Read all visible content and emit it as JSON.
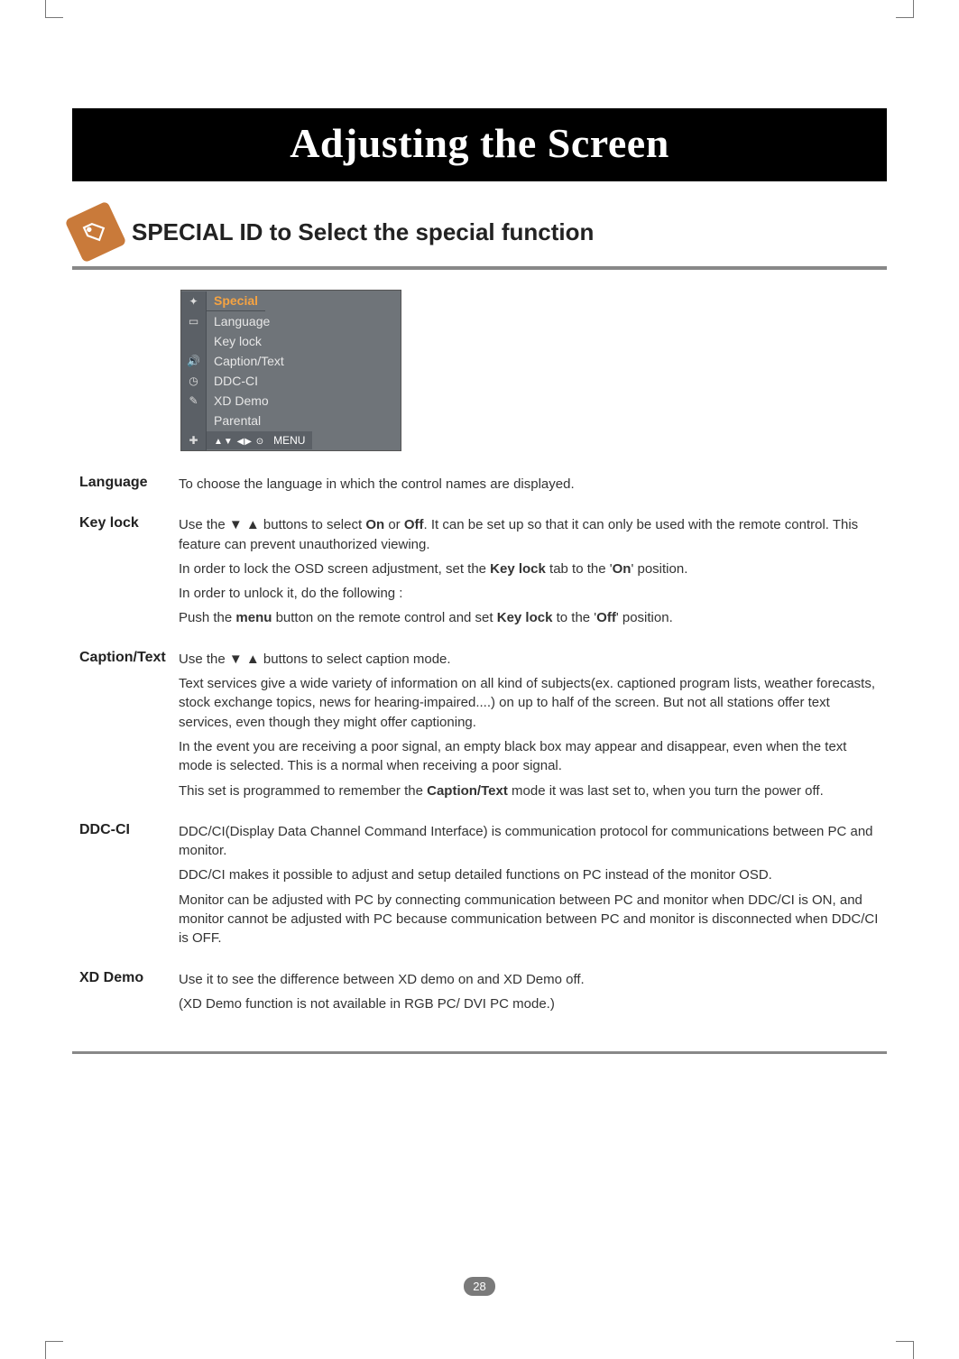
{
  "title": "Adjusting the Screen",
  "section_heading": "SPECIAL ID to Select the special function",
  "osd": {
    "header": "Special",
    "items": [
      "Language",
      "Key lock",
      "Caption/Text",
      "DDC-CI",
      "XD Demo",
      "Parental"
    ],
    "footer_glyphs": "▲▼  ◀▶  ⊙",
    "footer_label": "MENU"
  },
  "definitions": {
    "language": {
      "label": "Language",
      "text": "To choose the language in which the control names are displayed."
    },
    "keylock": {
      "label": "Key lock",
      "p1_prefix": "Use the ",
      "p1_glyphs": "▼ ▲",
      "p1_mid": " buttons to select ",
      "p1_on": "On",
      "p1_or": " or ",
      "p1_off": "Off",
      "p1_suffix": ". It can be set up so that it can only be used with the remote control. This feature can prevent unauthorized viewing.",
      "p2_a": "In order to lock the OSD screen adjustment, set the ",
      "p2_b": "Key lock",
      "p2_c": " tab to the '",
      "p2_d": "On",
      "p2_e": "' position.",
      "p3": "In order to unlock it, do the following :",
      "p4_a": "Push the ",
      "p4_b": "menu",
      "p4_c": " button on the remote control and set ",
      "p4_d": "Key lock",
      "p4_e": " to the '",
      "p4_f": "Off",
      "p4_g": "' position."
    },
    "caption": {
      "label": "Caption/Text",
      "p1_prefix": "Use the ",
      "p1_glyphs": "▼ ▲",
      "p1_suffix": " buttons to select caption mode.",
      "p2": "Text services give a wide variety of information on all kind of subjects(ex. captioned program lists, weather forecasts, stock exchange topics, news for hearing-impaired....) on up to half of the screen. But not all stations offer text services, even though they might offer captioning.",
      "p3": "In the event you are receiving a poor signal, an empty black box may appear and disappear, even when the text mode is selected. This is a normal when receiving a poor signal.",
      "p4_a": "This set is programmed to remember the ",
      "p4_b": "Caption/Text",
      "p4_c": " mode it was last set to, when you turn the power off."
    },
    "ddcci": {
      "label": "DDC-CI",
      "p1": "DDC/CI(Display Data Channel Command Interface) is communication protocol for communications between PC and monitor.",
      "p2": "DDC/CI makes it possible to adjust and setup detailed functions on PC instead of the monitor OSD.",
      "p3": "Monitor can be adjusted with PC by connecting communication between PC and monitor when DDC/CI is ON, and monitor cannot be adjusted with PC because communication between PC and monitor is disconnected when DDC/CI is OFF."
    },
    "xddemo": {
      "label": "XD Demo",
      "p1": "Use it to see the difference between XD demo on and XD Demo off.",
      "p2": "(XD Demo function is not available in RGB PC/ DVI PC mode.)"
    }
  },
  "page_number": "28"
}
